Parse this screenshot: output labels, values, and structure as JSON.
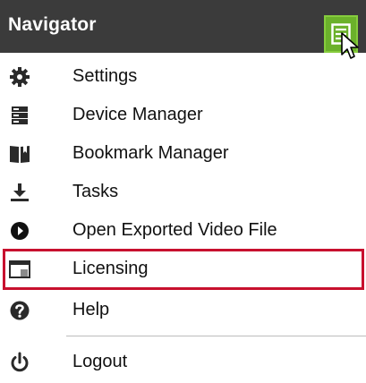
{
  "header": {
    "title": "Navigator",
    "menu_icon": "list-document-icon"
  },
  "menu": {
    "items": [
      {
        "label": "Settings",
        "icon": "gear-icon"
      },
      {
        "label": "Device Manager",
        "icon": "server-rack-icon"
      },
      {
        "label": "Bookmark Manager",
        "icon": "bookmark-book-icon"
      },
      {
        "label": "Tasks",
        "icon": "download-icon"
      },
      {
        "label": "Open Exported Video File",
        "icon": "play-circle-icon"
      },
      {
        "label": "Licensing",
        "icon": "license-window-icon",
        "highlighted": true
      },
      {
        "label": "Help",
        "icon": "question-circle-icon"
      },
      {
        "label": "Logout",
        "icon": "power-icon"
      }
    ]
  },
  "colors": {
    "header_bg": "#3b3b3b",
    "menu_button_bg": "#6bb12b",
    "highlight_border": "#c8102e"
  }
}
